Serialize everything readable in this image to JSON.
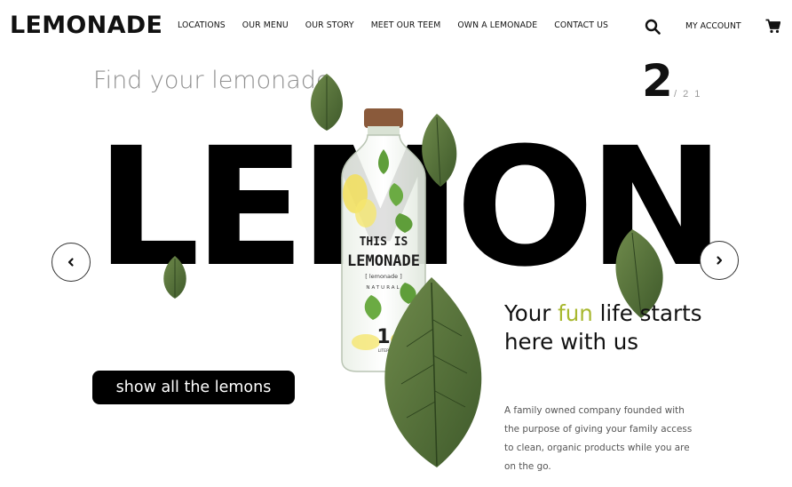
{
  "header": {
    "logo": "LEMONADE",
    "nav": [
      "LOCATIONS",
      "OUR MENU",
      "OUR STORY",
      "MEET OUR TEEM",
      "OWN A LEMONADE",
      "CONTACT US"
    ],
    "account_label": "MY ACCOUNT",
    "icons": [
      "search-icon",
      "cart-icon"
    ]
  },
  "hero": {
    "eyebrow": "Find your lemonade",
    "slide_current": "2",
    "slide_total": "/ 2 1",
    "headline": "LEMON",
    "tagline_pre": "Your ",
    "tagline_highlight": "fun",
    "tagline_post": " life starts here with us",
    "description": "A family owned company founded with the purpose of giving your family access to clean, organic products while you are on the go.",
    "cta_label": "show all the lemons",
    "bottle": {
      "label_line1": "THIS IS",
      "label_line2": "LEMONADE",
      "label_line3": "[ lemonade ]",
      "label_line4": "NATURAL",
      "volume": "1",
      "volume_unit": "LITER"
    }
  },
  "colors": {
    "accent": "#a8b82f",
    "text": "#111111",
    "muted": "#8f8f8f",
    "leaf": "#4f6d35",
    "cap": "#8a5a3b"
  }
}
